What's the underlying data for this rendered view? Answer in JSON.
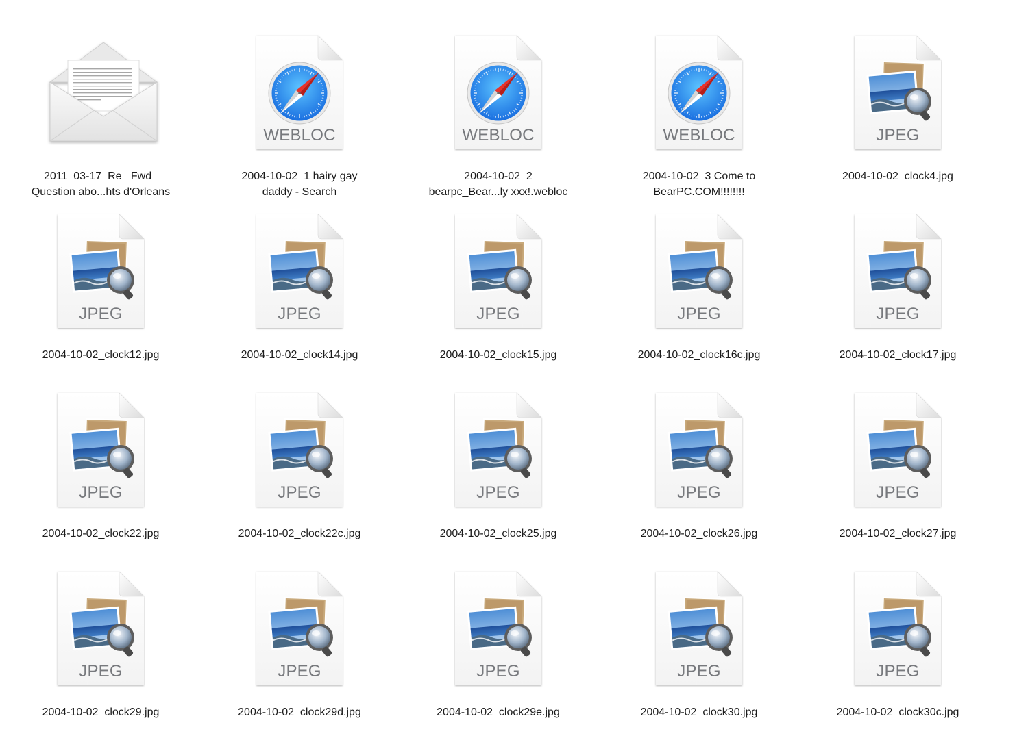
{
  "files": [
    {
      "name": "2011_03-17_Re_ Fwd_\nQuestion abo...hts d'Orleans",
      "kind": "",
      "type": "mail",
      "icon": "mail-envelope-icon"
    },
    {
      "name": "2004-10-02_1 hairy gay\ndaddy - Search",
      "kind": "WEBLOC",
      "type": "webloc",
      "icon": "safari-compass-icon"
    },
    {
      "name": "2004-10-02_2\nbearpc_Bear...ly xxx!.webloc",
      "kind": "WEBLOC",
      "type": "webloc",
      "icon": "safari-compass-icon"
    },
    {
      "name": "2004-10-02_3 Come to\nBearPC.COM!!!!!!!!",
      "kind": "WEBLOC",
      "type": "webloc",
      "icon": "safari-compass-icon"
    },
    {
      "name": "2004-10-02_clock4.jpg",
      "kind": "JPEG",
      "type": "jpeg",
      "icon": "preview-photo-icon"
    },
    {
      "name": "2004-10-02_clock12.jpg",
      "kind": "JPEG",
      "type": "jpeg",
      "icon": "preview-photo-icon"
    },
    {
      "name": "2004-10-02_clock14.jpg",
      "kind": "JPEG",
      "type": "jpeg",
      "icon": "preview-photo-icon"
    },
    {
      "name": "2004-10-02_clock15.jpg",
      "kind": "JPEG",
      "type": "jpeg",
      "icon": "preview-photo-icon"
    },
    {
      "name": "2004-10-02_clock16c.jpg",
      "kind": "JPEG",
      "type": "jpeg",
      "icon": "preview-photo-icon"
    },
    {
      "name": "2004-10-02_clock17.jpg",
      "kind": "JPEG",
      "type": "jpeg",
      "icon": "preview-photo-icon"
    },
    {
      "name": "2004-10-02_clock22.jpg",
      "kind": "JPEG",
      "type": "jpeg",
      "icon": "preview-photo-icon"
    },
    {
      "name": "2004-10-02_clock22c.jpg",
      "kind": "JPEG",
      "type": "jpeg",
      "icon": "preview-photo-icon"
    },
    {
      "name": "2004-10-02_clock25.jpg",
      "kind": "JPEG",
      "type": "jpeg",
      "icon": "preview-photo-icon"
    },
    {
      "name": "2004-10-02_clock26.jpg",
      "kind": "JPEG",
      "type": "jpeg",
      "icon": "preview-photo-icon"
    },
    {
      "name": "2004-10-02_clock27.jpg",
      "kind": "JPEG",
      "type": "jpeg",
      "icon": "preview-photo-icon"
    },
    {
      "name": "2004-10-02_clock29.jpg",
      "kind": "JPEG",
      "type": "jpeg",
      "icon": "preview-photo-icon"
    },
    {
      "name": "2004-10-02_clock29d.jpg",
      "kind": "JPEG",
      "type": "jpeg",
      "icon": "preview-photo-icon"
    },
    {
      "name": "2004-10-02_clock29e.jpg",
      "kind": "JPEG",
      "type": "jpeg",
      "icon": "preview-photo-icon"
    },
    {
      "name": "2004-10-02_clock30.jpg",
      "kind": "JPEG",
      "type": "jpeg",
      "icon": "preview-photo-icon"
    },
    {
      "name": "2004-10-02_clock30c.jpg",
      "kind": "JPEG",
      "type": "jpeg",
      "icon": "preview-photo-icon"
    }
  ],
  "colors": {
    "background": "#ffffff",
    "label_text": "#1c1c1c",
    "kind_text": "#77797d",
    "safari_blue": "#1d8ff2",
    "compass_red": "#e8322b"
  }
}
